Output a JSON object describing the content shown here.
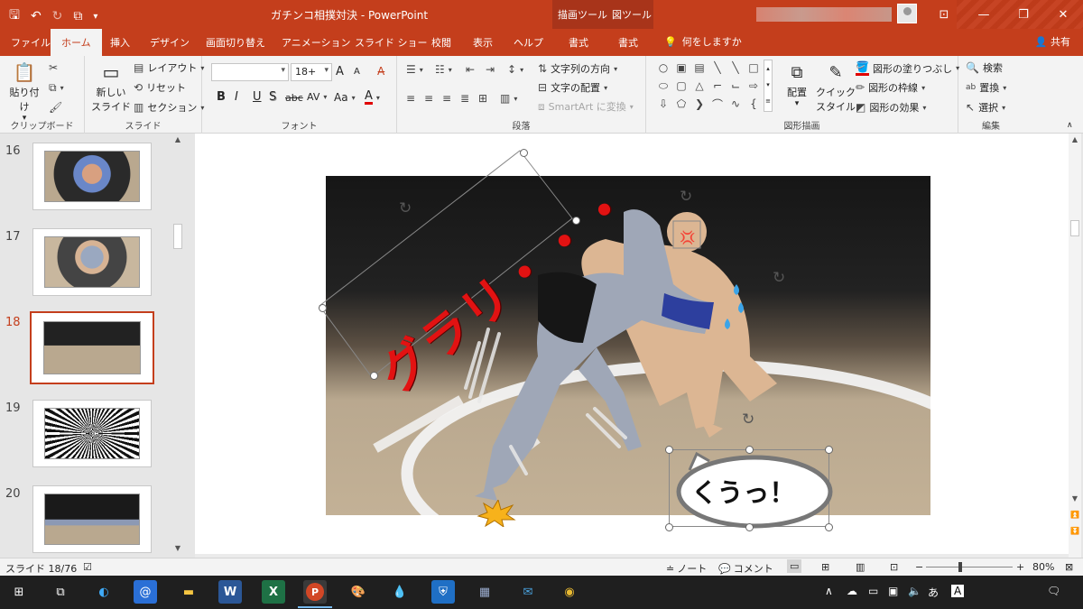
{
  "window": {
    "title": "ガチンコ相撲対決 - PowerPoint",
    "context_tool_drawing": "描画ツール",
    "context_tool_picture": "図ツール",
    "min": "—",
    "restore": "❐",
    "close": "✕",
    "ribbon_display": "⊡"
  },
  "qat": {
    "save": "🖫",
    "undo": "↶",
    "redo": "↻",
    "present": "⧉",
    "customize": "▾"
  },
  "tabs": [
    {
      "label": "ファイル"
    },
    {
      "label": "ホーム"
    },
    {
      "label": "挿入"
    },
    {
      "label": "デザイン"
    },
    {
      "label": "画面切り替え"
    },
    {
      "label": "アニメーション"
    },
    {
      "label": "スライド ショー"
    },
    {
      "label": "校閲"
    },
    {
      "label": "表示"
    },
    {
      "label": "ヘルプ"
    },
    {
      "label": "書式"
    },
    {
      "label": "書式"
    }
  ],
  "tell_me": "何をしますか",
  "share": "共有",
  "ribbon": {
    "clipboard": {
      "paste": "貼り付け",
      "label": "クリップボード"
    },
    "slides": {
      "new_slide_1": "新しい",
      "new_slide_2": "スライド",
      "layout": "レイアウト",
      "reset": "リセット",
      "section": "セクション",
      "label": "スライド"
    },
    "font": {
      "font_name": "",
      "font_size": "18+",
      "bold": "B",
      "italic": "I",
      "underline": "U",
      "shadow": "S",
      "strike": "abc",
      "spacing": "AV",
      "case": "Aa",
      "color": "A",
      "grow": "A",
      "shrink": "A",
      "label": "フォント"
    },
    "paragraph": {
      "text_direction": "文字列の方向",
      "align_text": "文字の配置",
      "smartart": "SmartArt に変換",
      "label": "段落"
    },
    "drawing": {
      "arrange": "配置",
      "quick_style_1": "クイック",
      "quick_style_2": "スタイル",
      "fill": "図形の塗りつぶし",
      "outline": "図形の枠線",
      "effects": "図形の効果",
      "label": "図形描画"
    },
    "editing": {
      "find": "検索",
      "replace": "置換",
      "select": "選択",
      "label": "編集"
    }
  },
  "thumbnails": [
    {
      "num": "16"
    },
    {
      "num": "17"
    },
    {
      "num": "18"
    },
    {
      "num": "19"
    },
    {
      "num": "20"
    }
  ],
  "slide": {
    "caption_text": "グラリ・・・",
    "bubble_text": "くうっ！"
  },
  "status": {
    "slide_info": "スライド 18/76",
    "notes": "ノート",
    "comments": "コメント",
    "zoom_minus": "−",
    "zoom_plus": "+",
    "zoom": "80%"
  },
  "taskbar": {
    "ime": "あ"
  }
}
